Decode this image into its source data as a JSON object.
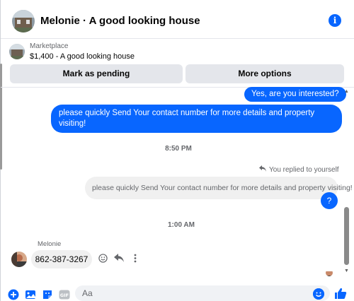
{
  "header": {
    "title": "Melonie · A good looking house",
    "info_icon": "info-icon"
  },
  "listing": {
    "kind": "Marketplace",
    "title": "$1,400 - A good looking house"
  },
  "actions": {
    "pending_label": "Mark as pending",
    "more_label": "More options"
  },
  "messages": {
    "out_1": "Yes, are you interested?",
    "out_2": "please quickly Send Your contact number for more details and property visiting!",
    "time_1": "8:50 PM",
    "replied_note": "You replied to yourself",
    "quoted": "please quickly Send Your contact number for more details and property visiting!",
    "out_3": "?",
    "time_2": "1:00 AM",
    "sender_name": "Melonie",
    "in_1": "862-387-3267"
  },
  "composer": {
    "placeholder": "Aa"
  },
  "colors": {
    "accent": "#0866ff",
    "bubble_grey": "#f0f0f0",
    "button_grey": "#e4e6eb",
    "muted_text": "#65676b"
  }
}
